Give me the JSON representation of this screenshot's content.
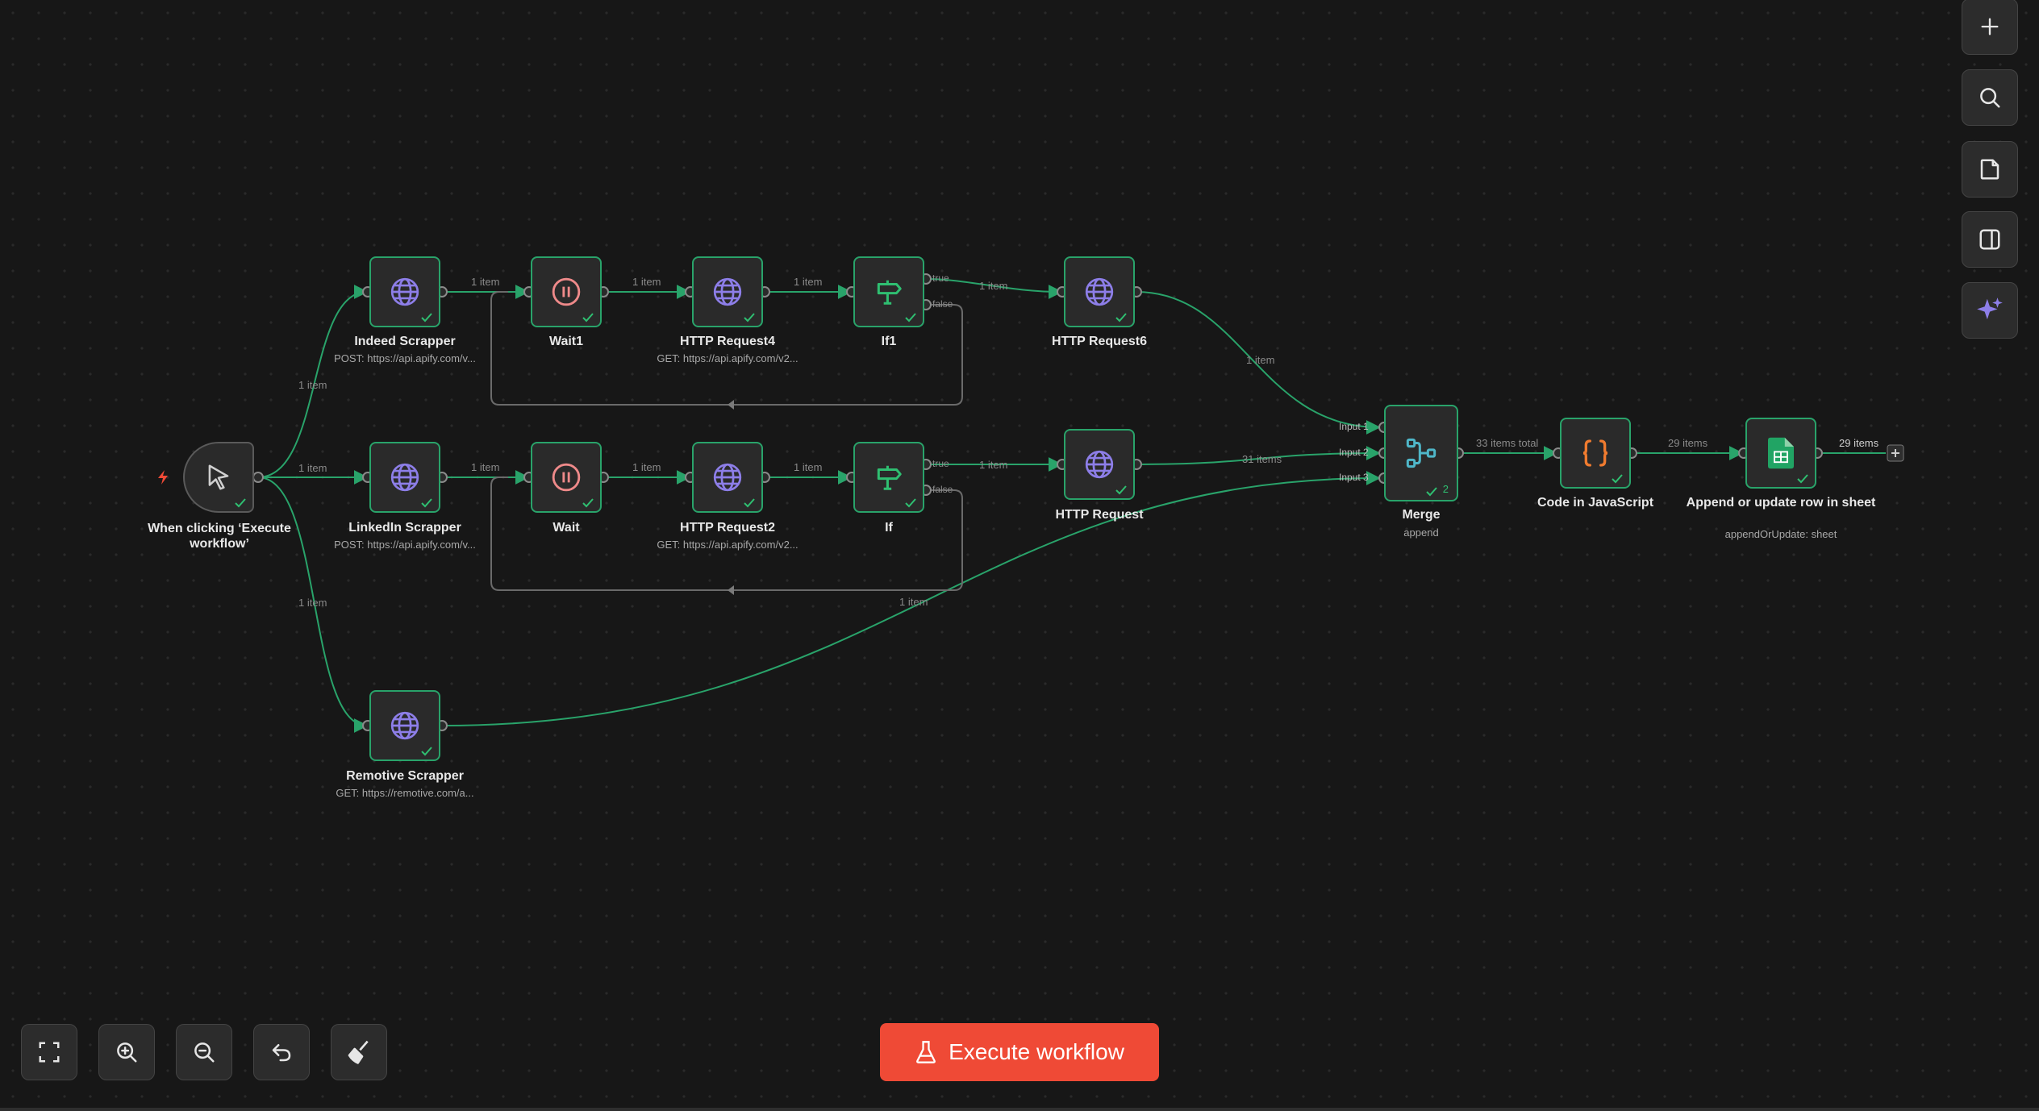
{
  "colors": {
    "accent_green": "#29a36a",
    "execute_button": "#ef4a36",
    "globe_icon": "#8d7ee8",
    "wait_icon": "#ef8a8a",
    "if_icon": "#2fbf71",
    "code_icon": "#f07b2f",
    "merge_icon": "#4fb7c9",
    "sheets_icon": "#21a464",
    "background": "#171717"
  },
  "nodes": {
    "trigger": {
      "name": "When clicking ‘Execute workflow’",
      "icon": "cursor-icon"
    },
    "indeed": {
      "name": "Indeed Scrapper",
      "sub": "POST: https://api.apify.com/v...",
      "icon": "globe-icon"
    },
    "wait1": {
      "name": "Wait1",
      "icon": "pause-icon"
    },
    "http4": {
      "name": "HTTP Request4",
      "sub": "GET: https://api.apify.com/v2...",
      "icon": "globe-icon"
    },
    "if1": {
      "name": "If1",
      "icon": "signpost-icon"
    },
    "http6": {
      "name": "HTTP Request6",
      "icon": "globe-icon"
    },
    "linkedin": {
      "name": "LinkedIn Scrapper",
      "sub": "POST: https://api.apify.com/v...",
      "icon": "globe-icon"
    },
    "wait": {
      "name": "Wait",
      "icon": "pause-icon"
    },
    "http2": {
      "name": "HTTP Request2",
      "sub": "GET: https://api.apify.com/v2...",
      "icon": "globe-icon"
    },
    "if": {
      "name": "If",
      "icon": "signpost-icon"
    },
    "http": {
      "name": "HTTP Request",
      "icon": "globe-icon"
    },
    "remotive": {
      "name": "Remotive Scrapper",
      "sub": "GET: https://remotive.com/a...",
      "icon": "globe-icon"
    },
    "merge": {
      "name": "Merge",
      "sub": "append",
      "count": "2",
      "icon": "merge-icon"
    },
    "code": {
      "name": "Code in JavaScript",
      "icon": "curly-braces-icon"
    },
    "sheets": {
      "name": "Append or update row in sheet",
      "sub": "appendOrUpdate: sheet",
      "icon": "google-sheets-icon"
    }
  },
  "edges": {
    "trigger_indeed": "1 item",
    "trigger_linkedin": "1 item",
    "trigger_remotive": "1 item",
    "indeed_wait1": "1 item",
    "wait1_http4": "1 item",
    "http4_if1": "1 item",
    "if1_http6": "1 item",
    "http6_merge": "1 item",
    "linkedin_wait": "1 item",
    "wait_http2": "1 item",
    "http2_if": "1 item",
    "if_http": "1 item",
    "http_merge": "31 items",
    "remotive_merge": "1 item",
    "merge_code": "33 items total",
    "code_sheets": "29 items",
    "sheets_out": "29 items"
  },
  "ports": {
    "true": "true",
    "false": "false",
    "input1": "Input 1",
    "input2": "Input 2",
    "input3": "Input 3"
  },
  "toolbar_right": [
    "plus-icon",
    "search-icon",
    "sticky-note-icon",
    "panel-toggle-icon",
    "ai-sparkle-icon"
  ],
  "toolbar_bottom": [
    "fit-view-icon",
    "zoom-in-icon",
    "zoom-out-icon",
    "undo-icon",
    "clear-execution-icon"
  ],
  "execute_button": {
    "label": "Execute workflow",
    "icon": "flask-icon"
  }
}
